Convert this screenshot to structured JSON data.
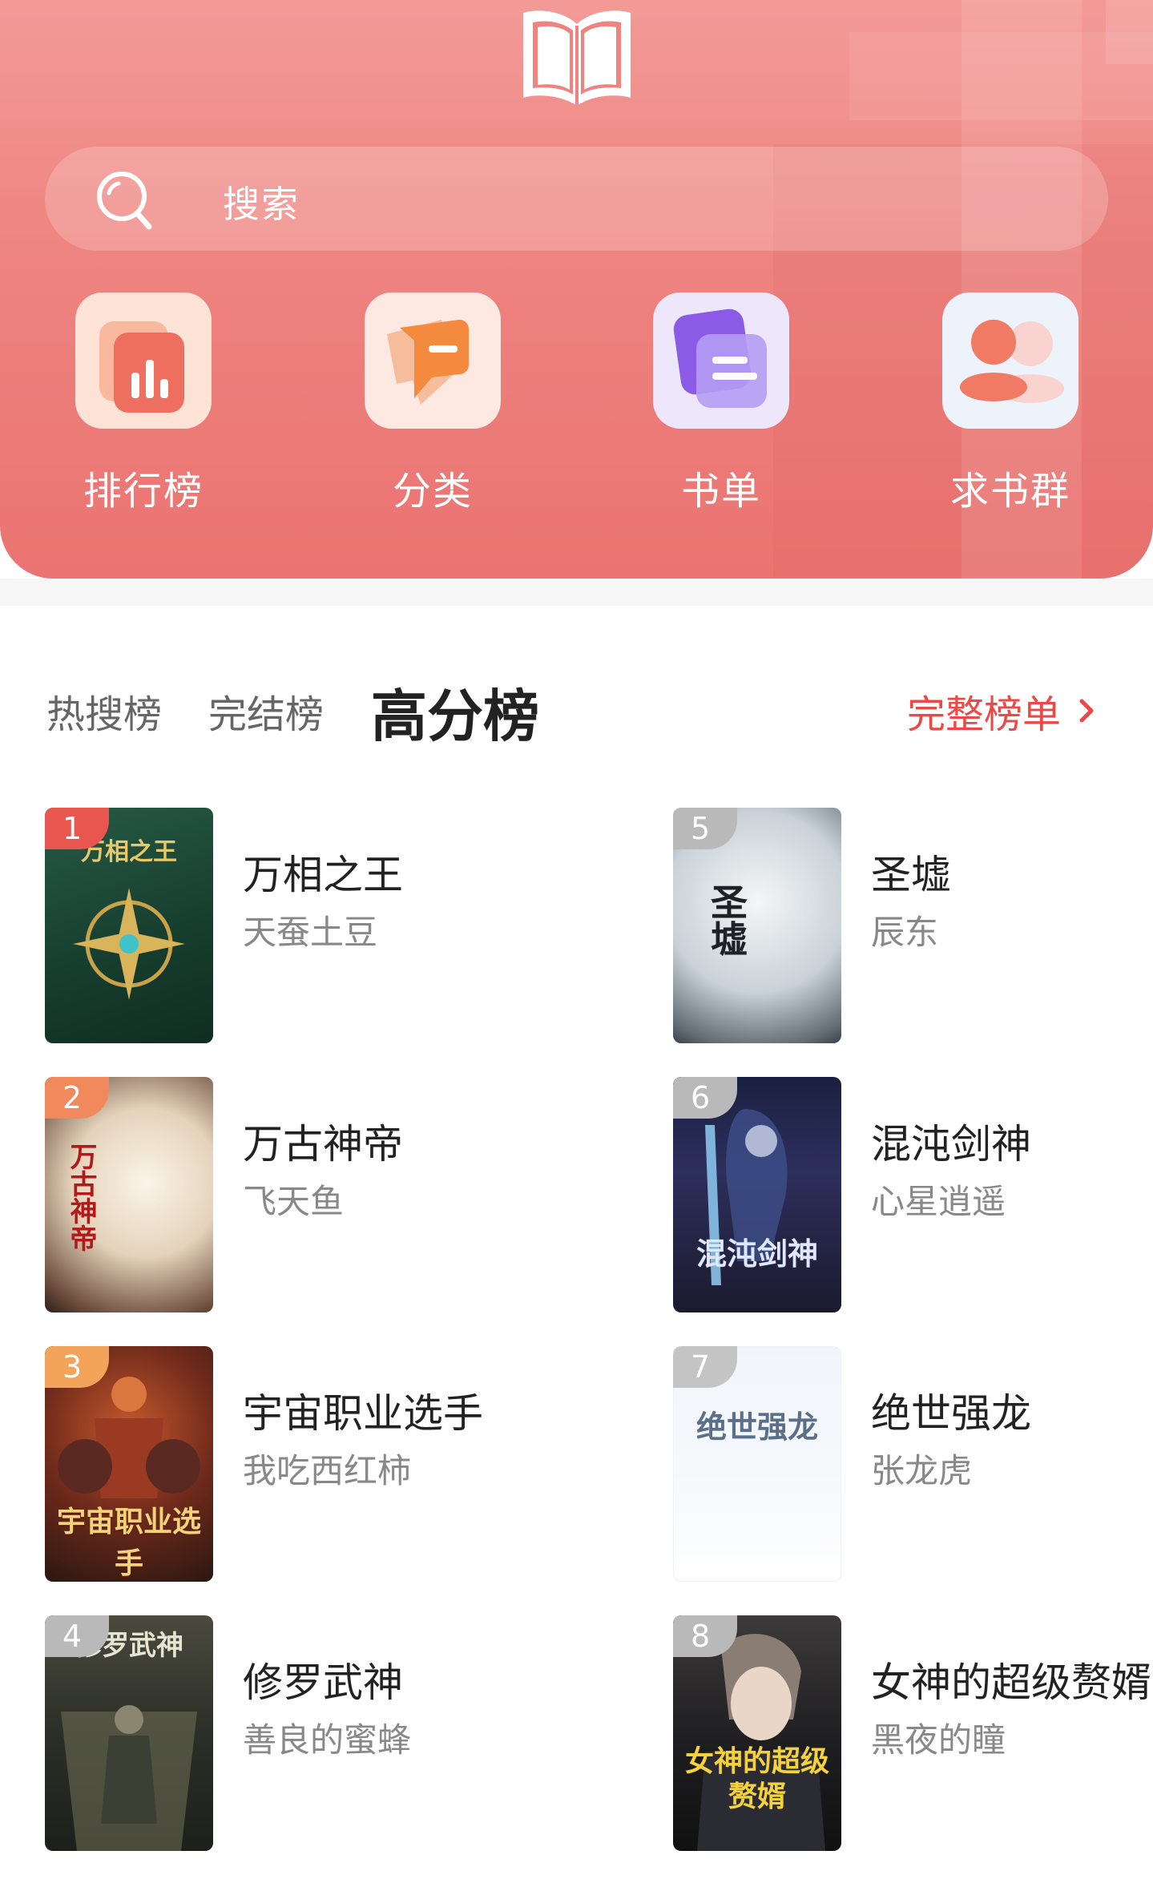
{
  "header": {
    "search_placeholder": "搜索",
    "quick_actions": [
      {
        "label": "排行榜",
        "icon": "ranking-chart-icon"
      },
      {
        "label": "分类",
        "icon": "category-tag-icon"
      },
      {
        "label": "书单",
        "icon": "booklist-icon"
      },
      {
        "label": "求书群",
        "icon": "group-users-icon"
      }
    ]
  },
  "tabs": [
    {
      "label": "热搜榜",
      "active": false
    },
    {
      "label": "完结榜",
      "active": false
    },
    {
      "label": "高分榜",
      "active": true
    }
  ],
  "full_list_label": "完整榜单",
  "books": [
    {
      "rank": "1",
      "title": "万相之王",
      "author": "天蚕土豆",
      "cover_text": "万相之王"
    },
    {
      "rank": "2",
      "title": "万古神帝",
      "author": "飞天鱼",
      "cover_text": "万古神帝"
    },
    {
      "rank": "3",
      "title": "宇宙职业选手",
      "author": "我吃西红柿",
      "cover_text": "宇宙职业选手"
    },
    {
      "rank": "4",
      "title": "修罗武神",
      "author": "善良的蜜蜂",
      "cover_text": "修罗武神"
    },
    {
      "rank": "5",
      "title": "圣墟",
      "author": "辰东",
      "cover_text": "圣墟"
    },
    {
      "rank": "6",
      "title": "混沌剑神",
      "author": "心星逍遥",
      "cover_text": "混沌剑神"
    },
    {
      "rank": "7",
      "title": "绝世强龙",
      "author": "张龙虎",
      "cover_text": "绝世强龙"
    },
    {
      "rank": "8",
      "title": "女神的超级赘婿",
      "author": "黑夜的瞳",
      "cover_text": "女神的超级赘婿"
    }
  ],
  "colors": {
    "header_bg": "#ee837f",
    "accent": "#ea4a47",
    "rank_top": "#e8564f",
    "rank_gray": "#b9b9b9"
  }
}
